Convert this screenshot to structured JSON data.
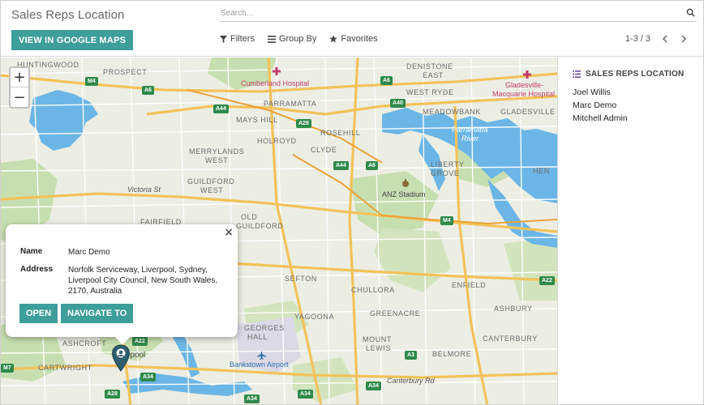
{
  "page": {
    "title": "Sales Reps Location",
    "google_maps_button": "VIEW IN GOOGLE MAPS"
  },
  "search": {
    "placeholder": "Search..."
  },
  "filters": {
    "filters_label": "Filters",
    "group_by_label": "Group By",
    "favorites_label": "Favorites"
  },
  "pager": {
    "value": "1-3 / 3"
  },
  "map": {
    "labels": {
      "huntingwood": "HUNTINGWOOD",
      "prospect": "PROSPECT",
      "cumberland": "Cumberland Hospital",
      "denistone": "DENISTONE",
      "east": "EAST",
      "gladesville": "Gladesville-",
      "macquarie": "Macquarie Hospital",
      "west_ryde": "WEST RYDE",
      "parramatta": "PARRAMATTA",
      "meadowbank": "MEADOWBANK",
      "mays_hill": "MAYS HILL",
      "parramatta_river": "Parramatta",
      "river": "River",
      "gladesville2": "GLADESVILLE",
      "rosehill": "ROSEHILL",
      "holroyd": "HOLROYD",
      "clyde": "CLYDE",
      "merrylands": "MERRYLANDS",
      "west1": "WEST",
      "liberty": "LIBERTY",
      "grove": "GROVE",
      "hen": "HEN",
      "victoria_st": "Victoria St",
      "guildford": "GUILDFORD",
      "west2": "WEST",
      "anz": "ANZ Stadium",
      "fairfield": "FAIRFIELD",
      "old": "OLD",
      "guildford2": "GUILDFORD",
      "sefton": "SEFTON",
      "chullora": "CHULLORA",
      "enfield": "ENFIELD",
      "yagoona": "YAGOONA",
      "greenacre": "GREENACRE",
      "ashbury": "ASHBURY",
      "georges": "GEORGES",
      "hall": "HALL",
      "mount": "MOUNT",
      "lewis": "LEWIS",
      "canterbury": "CANTERBURY",
      "ashcroft": "ASHCROFT",
      "liverpool": "rpool",
      "belmore": "BELMORE",
      "cartwright": "CARTWRIGHT",
      "bankstown": "Bankstown Airport",
      "canterbury_rd": "Canterbury Rd"
    },
    "shields": {
      "m4a": "M4",
      "a6a": "A6",
      "a6b": "A6",
      "a40": "A40",
      "a44a": "A44",
      "a28a": "A28",
      "a44b": "A44",
      "a6c": "A6",
      "m4b": "M4",
      "a22a": "A22",
      "a22b": "A22",
      "a3": "A3",
      "a34a": "A34",
      "m7": "M7",
      "a28b": "A28",
      "a34b": "A34",
      "a34c": "A34",
      "a34d": "A34"
    },
    "zoom_in": "+",
    "zoom_out": "−"
  },
  "popup": {
    "close": "×",
    "name_key": "Name",
    "name_val": "Marc Demo",
    "address_key": "Address",
    "address_val": "Norfolk Serviceway, Liverpool, Sydney, Liverpool City Council, New South Wales, 2170, Australia",
    "open_label": "OPEN",
    "navigate_label": "NAVIGATE TO"
  },
  "side_panel": {
    "title": "SALES REPS LOCATION",
    "reps": [
      "Joel Willis",
      "Marc Demo",
      "Mitchell Admin"
    ]
  },
  "colors": {
    "accent": "#3e9e9a",
    "water": "#6bb6e6",
    "park": "#c7dfb0",
    "road_major": "#f3c25a",
    "shield": "#2f8a4b"
  }
}
